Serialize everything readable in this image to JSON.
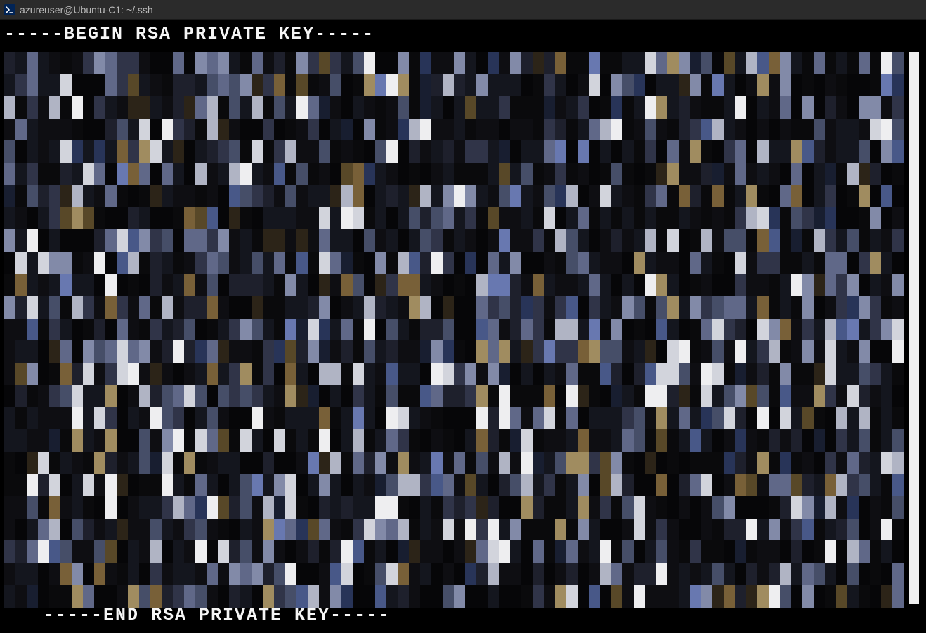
{
  "titlebar": {
    "title": "azureuser@Ubuntu-C1: ~/.ssh"
  },
  "terminal": {
    "begin_line": "-----BEGIN RSA PRIVATE KEY-----",
    "end_line": "-----END RSA PRIVATE KEY-----",
    "obscured_block": {
      "type": "pixelated",
      "rows": 25,
      "cols": 80
    }
  }
}
